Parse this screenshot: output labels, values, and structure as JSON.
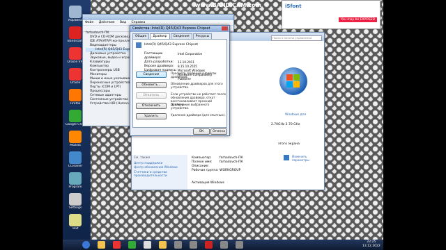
{
  "watermark": "www.BANDICAM.com",
  "colors": {
    "accent": "#2a6ab6",
    "desktop": "#1b3766",
    "taskbar": "#162744"
  },
  "desktop_icons": [
    {
      "label": "Корзина",
      "icon": "recycle-bin-icon",
      "color": "#9fb7d0"
    },
    {
      "label": "Bandicam",
      "icon": "bandicam-icon",
      "color": "#d22"
    },
    {
      "label": "Oracle VM",
      "icon": "virtualbox-icon",
      "color": "#e33"
    },
    {
      "label": "Oracle",
      "icon": "oracle-icon",
      "color": "#e33"
    },
    {
      "label": "Firefox",
      "icon": "firefox-icon",
      "color": "#f70"
    },
    {
      "label": "Google Chrome",
      "icon": "chrome-icon",
      "color": "#3a3"
    },
    {
      "label": "Mozilla",
      "icon": "mozilla-icon",
      "color": "#f80"
    },
    {
      "label": "CCleaner",
      "icon": "ccleaner-icon",
      "color": "#48c"
    },
    {
      "label": "Program",
      "icon": "program-icon",
      "color": "#6ab"
    },
    {
      "label": "Settings",
      "icon": "settings-icon",
      "color": "#ccc"
    },
    {
      "label": "Text",
      "icon": "text-icon",
      "color": "#dd8"
    }
  ],
  "device_manager": {
    "title": "",
    "menu": [
      "Файл",
      "Действие",
      "Вид",
      "Справка"
    ],
    "tree": [
      "farhadovch-ПК",
      "DVD и CD-ROM дисководы",
      "IDE ATA/ATAPI контроллеры",
      "Видеоадаптеры",
      "Intel(R) Q45/Q43 Express Chipset",
      "Дисковые устройства",
      "Звуковые, видео и игровые",
      "Клавиатуры",
      "Компьютер",
      "Контроллеры USB",
      "Мониторы",
      "Мыши и иные указывающие",
      "Переносные устройства",
      "Порты (COM и LPT)",
      "Процессоры",
      "Сетевые адаптеры",
      "Системные устройства",
      "Устройства HID (Human Interface"
    ]
  },
  "properties_dialog": {
    "title": "Свойства: Intel(R) Q45/Q43 Express Chipset",
    "tabs": [
      "Общие",
      "Драйвер",
      "Сведения",
      "Ресурсы"
    ],
    "device_name": "Intel(R) Q45/Q43 Express Chipset",
    "fields": [
      {
        "k": "Поставщик драйвера:",
        "v": "Intel Corporation"
      },
      {
        "k": "Дата разработки:",
        "v": "13.10.2011"
      },
      {
        "k": "Версия драйвера:",
        "v": "8.15.10.2555"
      },
      {
        "k": "Цифровая подпись:",
        "v": "Microsoft Windows Hardware Compatibility Publisher"
      }
    ],
    "actions": [
      {
        "btn": "Сведения",
        "desc": "Просмотр сведений о файлах драйверов."
      },
      {
        "btn": "Обновить...",
        "desc": "Обновление драйверов для этого устройства."
      },
      {
        "btn": "Откатить",
        "desc": "Если устройство не работает после обновления драйвера, откат восстанавливает прежний драйвер."
      },
      {
        "btn": "Отключить",
        "desc": "Отключение выбранного устройства."
      },
      {
        "btn": "Удалить",
        "desc": "Удаление драйвера (для опытных)."
      }
    ],
    "ok": "ОК",
    "cancel": "Отмена"
  },
  "system_window": {
    "search_placeholder": "Поиск в панели управления",
    "windows_link": "Windows для",
    "cpu": "2.70GHz  2.70 GHz",
    "status": "этого экрана",
    "settings_link": "Изменить параметры",
    "sidebar": [
      "См. также",
      "Центр поддержки",
      "Центр обновления Windows",
      "Счетчики и средства производительности"
    ],
    "rows": [
      {
        "k": "Компьютер:",
        "v": "farhadovch-ПК"
      },
      {
        "k": "Полное имя:",
        "v": "farhadovch-ПК"
      },
      {
        "k": "Описание:",
        "v": ""
      },
      {
        "k": "Рабочая группа:",
        "v": "WORKGROUP"
      }
    ],
    "activation": "Активация Windows"
  },
  "isfont": {
    "title": "iSfont",
    "tag": "You may be EXPOSED"
  },
  "clock": {
    "time": "22:25",
    "date": "13.12.2022"
  },
  "taskbar_icons": [
    "start-orb-icon",
    "explorer-icon",
    "yandex-icon",
    "chrome-icon",
    "media-icon",
    "folder-icon",
    "app-icon",
    "app-icon",
    "record-icon",
    "app-icon",
    "app-icon"
  ]
}
